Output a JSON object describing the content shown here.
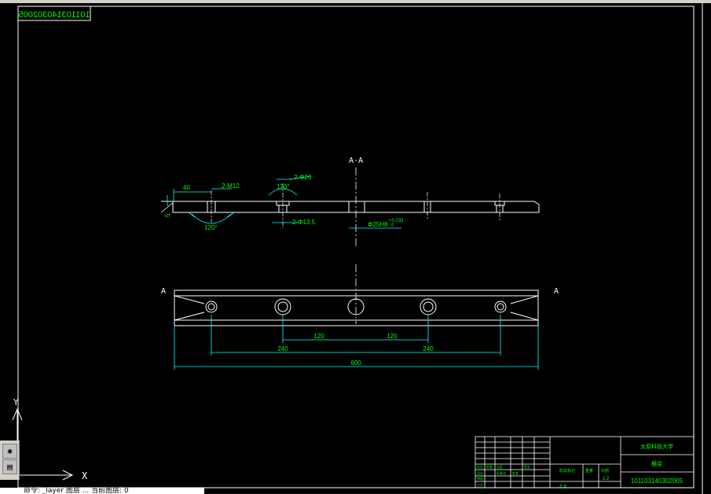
{
  "drawing": {
    "code_mirrored": "101103140302005",
    "section_label": "A-A",
    "view_mark_left": "A",
    "view_mark_right": "A",
    "dims": {
      "d40": "40",
      "holes_m12": "2-M12",
      "chamfer_left": "5",
      "angle_left": "120°",
      "holes_d20": "2-Φ20",
      "d120_top": "120°",
      "holes_d135": "2-Φ13.5",
      "fit_main": "Φ25H8",
      "fit_tol": "+0.033",
      "fit_zero": "0",
      "d120_a": "120",
      "d120_b": "120",
      "d240_a": "240",
      "d240_b": "240",
      "d600": "600"
    },
    "axis_x": "X",
    "axis_y": "Y"
  },
  "title_block": {
    "school": "太原科技大学",
    "part_name": "横梁",
    "drawing_no": "101103140302005",
    "scale_hdr": "比例",
    "scale_val": "1:2",
    "sheet_hdr": "共 张",
    "mark_hdr": "标记",
    "row_labels": [
      "标记",
      "处数",
      "分区",
      "更改文件号",
      "签名",
      "年月日"
    ],
    "design": "设计",
    "check": "审核",
    "process": "工艺",
    "std": "标准化",
    "approve": "批准",
    "stage": "阶段标记",
    "weight": "重量",
    "a": "A",
    "b": "B",
    "c": "C",
    "d": "D"
  },
  "command_line": "命令: _layer 图层 ... 当前图层: 0",
  "colors": {
    "line": "#ffffff",
    "dim": "#00ffff",
    "text": "#00ff00",
    "title": "#00ff00"
  }
}
